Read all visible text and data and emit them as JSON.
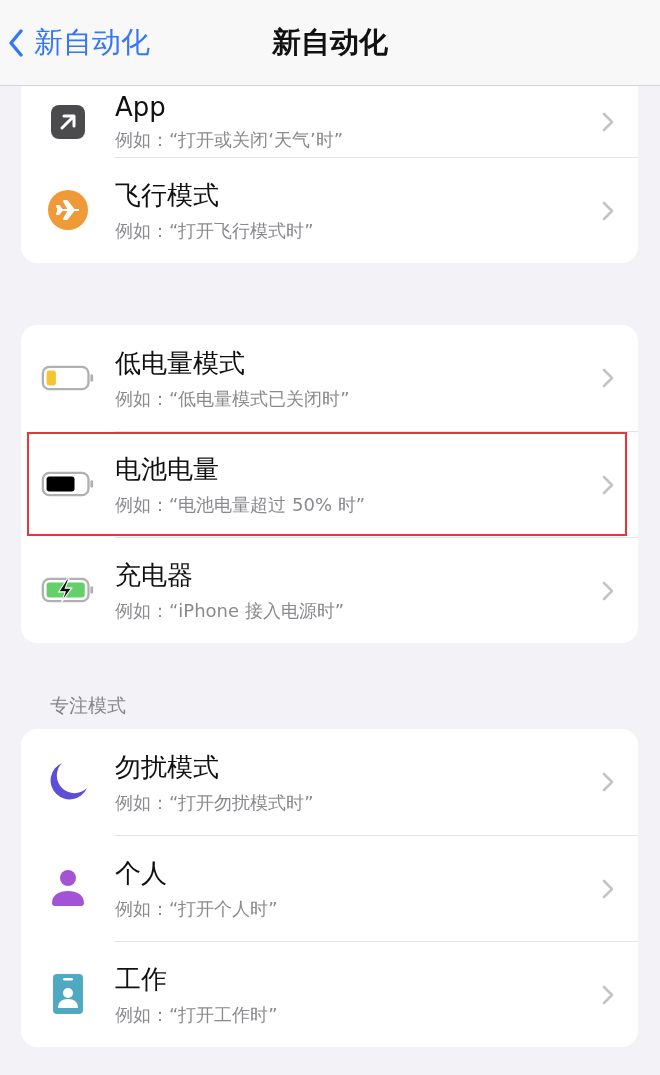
{
  "nav": {
    "back_label": "新自动化",
    "title": "新自动化"
  },
  "groups": [
    {
      "clipped_top": true,
      "items": [
        {
          "kind": "app",
          "title": "App",
          "subtitle": "例如：“打开或关闭‘天气’时”",
          "highlighted": false
        },
        {
          "kind": "airplane",
          "title": "飞行模式",
          "subtitle": "例如：“打开飞行模式时”",
          "highlighted": false
        }
      ]
    },
    {
      "clipped_top": false,
      "items": [
        {
          "kind": "battery-low",
          "title": "低电量模式",
          "subtitle": "例如：“低电量模式已关闭时”",
          "highlighted": false
        },
        {
          "kind": "battery-full",
          "title": "电池电量",
          "subtitle": "例如：“电池电量超过 50% 时”",
          "highlighted": true
        },
        {
          "kind": "battery-charging",
          "title": "充电器",
          "subtitle": "例如：“iPhone 接入电源时”",
          "highlighted": false
        }
      ]
    },
    {
      "header": "专注模式",
      "clipped_top": false,
      "items": [
        {
          "kind": "moon",
          "title": "勿扰模式",
          "subtitle": "例如：“打开勿扰模式时”",
          "highlighted": false
        },
        {
          "kind": "person",
          "title": "个人",
          "subtitle": "例如：“打开个人时”",
          "highlighted": false
        },
        {
          "kind": "badge",
          "title": "工作",
          "subtitle": "例如：“打开工作时”",
          "highlighted": false
        }
      ]
    }
  ]
}
